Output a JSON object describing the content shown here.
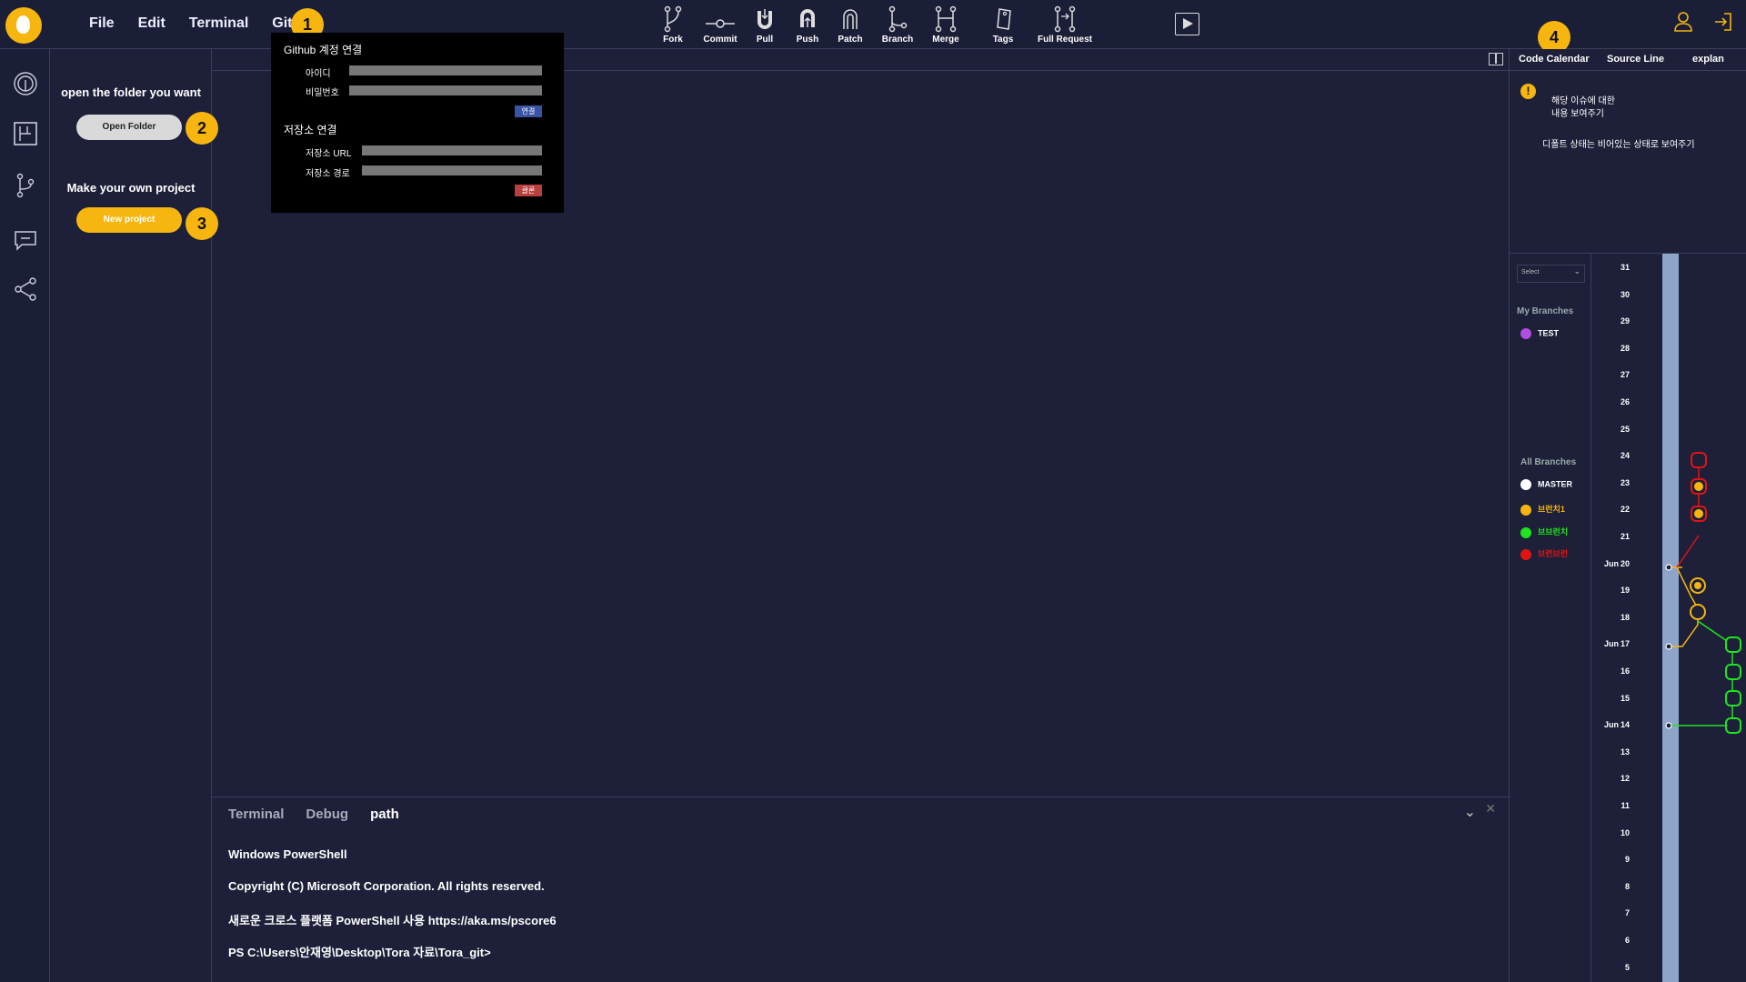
{
  "menu": [
    "File",
    "Edit",
    "Terminal",
    "Git"
  ],
  "toolbar": [
    {
      "label": "Fork",
      "icon": "fork-icon"
    },
    {
      "label": "Commit",
      "icon": "commit-icon"
    },
    {
      "label": "Pull",
      "icon": "pull-icon"
    },
    {
      "label": "Push",
      "icon": "push-icon"
    },
    {
      "label": "Patch",
      "icon": "patch-icon"
    },
    {
      "label": "Branch",
      "icon": "branch-icon"
    },
    {
      "label": "Merge",
      "icon": "merge-icon"
    },
    {
      "label": "Tags",
      "icon": "tag-icon"
    },
    {
      "label": "Full Request",
      "icon": "pull-request-icon"
    }
  ],
  "badges": [
    "1",
    "2",
    "3",
    "4"
  ],
  "explorer": {
    "open_text": "open the folder you want",
    "open_button": "Open Folder",
    "make_text": "Make your own project",
    "new_button": "New project"
  },
  "git_popup": {
    "account_title": "Github 계정 연결",
    "id_label": "아이디",
    "pw_label": "비밀번호",
    "connect_button": "연결",
    "repo_title": "저장소 연결",
    "url_label": "저장소 URL",
    "path_label": "저장소 경로",
    "clone_button": "클론"
  },
  "terminal": {
    "tabs": [
      "Terminal",
      "Debug",
      "path"
    ],
    "active_tab": "path",
    "lines": [
      "Windows PowerShell",
      "Copyright (C) Microsoft Corporation. All rights reserved.",
      "새로운 크로스 플랫폼 PowerShell 사용 https://aka.ms/pscore6",
      "PS C:\\Users\\안재영\\Desktop\\Tora 자료\\Tora_git>"
    ]
  },
  "right_panel": {
    "tabs": [
      "Code Calendar",
      "Source Line",
      "explan"
    ],
    "issue_line1": "해당 이슈에 대한",
    "issue_line2": "내용 보여주기",
    "default_note": "디폴트 상태는 비어있는 상태로 보여주기",
    "select_label": "Select",
    "my_branches_title": "My Branches",
    "my_branches": [
      {
        "name": "TEST",
        "color": "#b14fe0"
      }
    ],
    "all_branches_title": "All Branches",
    "all_branches": [
      {
        "name": "MASTER",
        "color": "#ffffff"
      },
      {
        "name": "브런치1",
        "color": "#f6b60f"
      },
      {
        "name": "브브런치",
        "color": "#1ee51e"
      },
      {
        "name": "브런브런",
        "color": "#e01414"
      }
    ],
    "dates": [
      31,
      30,
      29,
      28,
      27,
      26,
      25,
      24,
      23,
      22,
      21,
      20,
      19,
      18,
      17,
      16,
      15,
      14,
      13,
      12,
      11,
      10,
      9,
      8,
      7,
      6,
      5
    ],
    "month_labels": [
      {
        "day": 20,
        "label": "Jun"
      },
      {
        "day": 17,
        "label": "Jun"
      },
      {
        "day": 14,
        "label": "Jun"
      }
    ]
  },
  "colors": {
    "accent": "#f6b60f",
    "background": "#1d2038",
    "red": "#e01414",
    "green": "#1ee51e",
    "orange": "#f6b60f"
  }
}
